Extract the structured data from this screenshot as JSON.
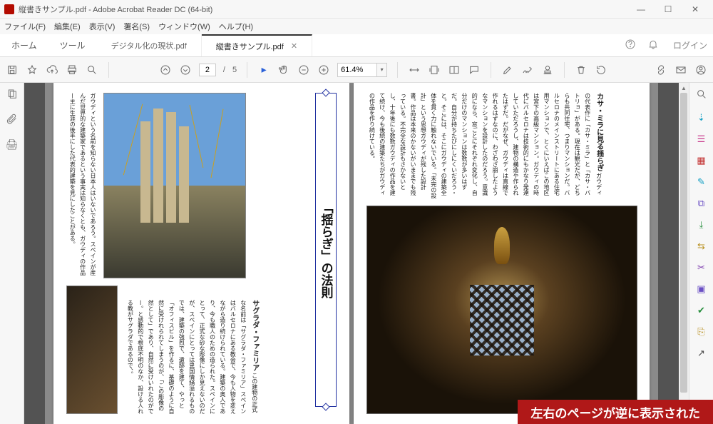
{
  "window": {
    "title": "縦書きサンプル.pdf - Adobe Acrobat Reader DC (64-bit)"
  },
  "menubar": [
    "ファイル(F)",
    "編集(E)",
    "表示(V)",
    "署名(S)",
    "ウィンドウ(W)",
    "ヘルプ(H)"
  ],
  "tabs": {
    "home": "ホーム",
    "tools": "ツール",
    "docs": [
      {
        "label": "デジタル化の現状.pdf",
        "active": false
      },
      {
        "label": "縦書きサンプル.pdf",
        "active": true
      }
    ],
    "login": "ログイン"
  },
  "toolbar": {
    "page_current": "2",
    "page_sep": "/",
    "page_total": "5",
    "zoom": "61.4%"
  },
  "document": {
    "headline": "「揺らぎ」の法則",
    "right_page": {
      "section_title": "カサ・ミラに見る揺らぎ",
      "paragraph": "ガウディの代表作に「カサ・ミラ」と「カサ・バトリョ」がある。現在は観光だが、どちらも共同住宅、つまりマンションだ。バルセロナのメインストリートにある住宅用マンションで、とくにいえばこの地区は宮下の高級マンション。ガウディの時代にバルセロナは技術的にもかなり発達していただろうし、建物の構造や作られたはずだ。だがなぜ、ガウディは直線で作れるはずなのに、わざわざ崩したようなマンションを設計したのだろう。意識的になら、窓ごとにそれぞれ変化し、自分だけのマンションは数数が多いはずだ。自分が持ちたびにしにくいだろう・と。そこには、そこにガウディの建築全体を貫く力に触れないでいる。「未完の設計」という思想ガウディが残した設計書。作品は本来のかないがいままでも残っている。不完全な設計もさかないとし、十年後にも数数ガウディの作品を建て続け、今も後続の建築たちがガウディの作品を作り続けている。"
    },
    "left_page": {
      "paragraph_top": "ガウディという名前を知らない日本人はいないであろう。スペインが産んだ世界的な建築家であるという事実は知らなくとも、ガウディの作品ー主に生涯の後半にした代表的建築を見にしたことがある。",
      "section_title": "サグラダ・ファミリア",
      "paragraph_bottom": "この建物の正式な名前は「サグラダ・ファミリア」スペインはバルセロナにある教会で、今も人物を変えながら造り続けられている。建築の奥人であり、今も職人のための造られた。スペインにとって、正式な砂な彫像にしか見えないのだが、スペインにとっては異国情緒溢れるものでは、建築の強烈で、遺跡を建て、やっと「オフィスビル」を作るに、基礎のように自然に受けれられてしまうのが、「この彫像の然として」であり、自然に受けいれたのがでー。と感動的で根底不明のなか、設ける人れる教がサグラダであるので、。"
    }
  },
  "banner": "左右のページが逆に表示された",
  "right_rail_colors": [
    "#666",
    "#16a0c4",
    "#c94090",
    "#c23030",
    "#16a0c4",
    "#6a4fc4",
    "#2a9040",
    "#b89020",
    "#8040b0",
    "#6a4fc4",
    "#2a9040",
    "#b89020",
    "#4a4a4a"
  ]
}
